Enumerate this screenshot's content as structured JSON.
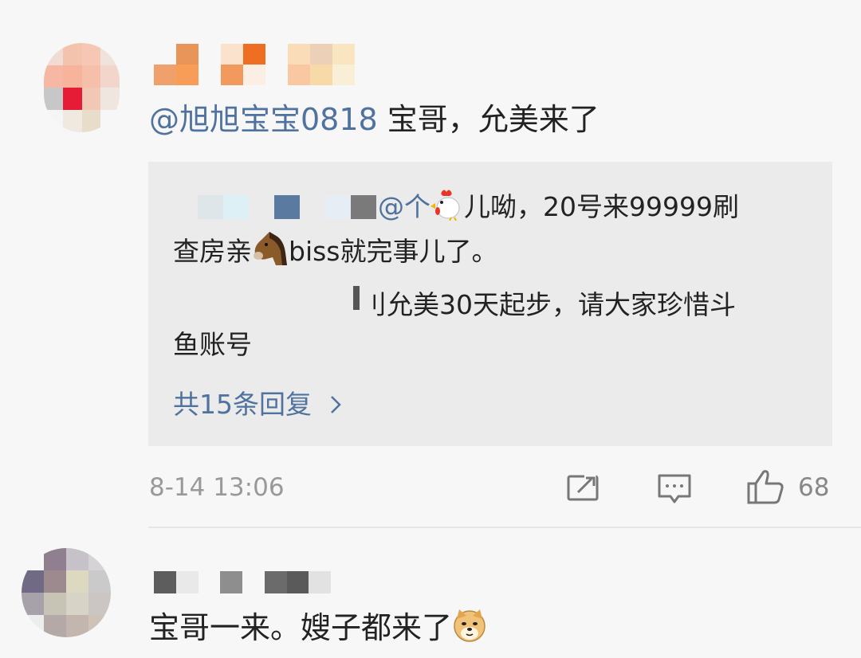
{
  "comments": [
    {
      "mention": "@旭旭宝宝0818",
      "text": " 宝哥，允美来了",
      "reply_box": {
        "line1_mention": "@个",
        "line1_emoji": "rooster-emoji",
        "line1_text": "儿呦，20号来99999刷",
        "line2_text_a": "查房亲",
        "line2_emoji": "horse-emoji",
        "line2_text_b": "biss就完事儿了。",
        "line3_text": "刂允美30天起步，请大家珍惜斗",
        "line4_text": "鱼账号",
        "more_replies": "共15条回复",
        "more_icon": "chevron-right-icon"
      },
      "timestamp": "8-14 13:06",
      "actions": {
        "share_icon": "share-edit-icon",
        "comment_icon": "comment-icon",
        "like_icon": "thumbs-up-icon",
        "like_count": "68"
      }
    },
    {
      "text": "宝哥一来。嫂子都来了",
      "emoji": "doge-emoji"
    }
  ],
  "colors": {
    "mention": "#50729e",
    "background": "#f7f7f7",
    "reply_background": "#ebebeb",
    "meta": "#999999"
  }
}
